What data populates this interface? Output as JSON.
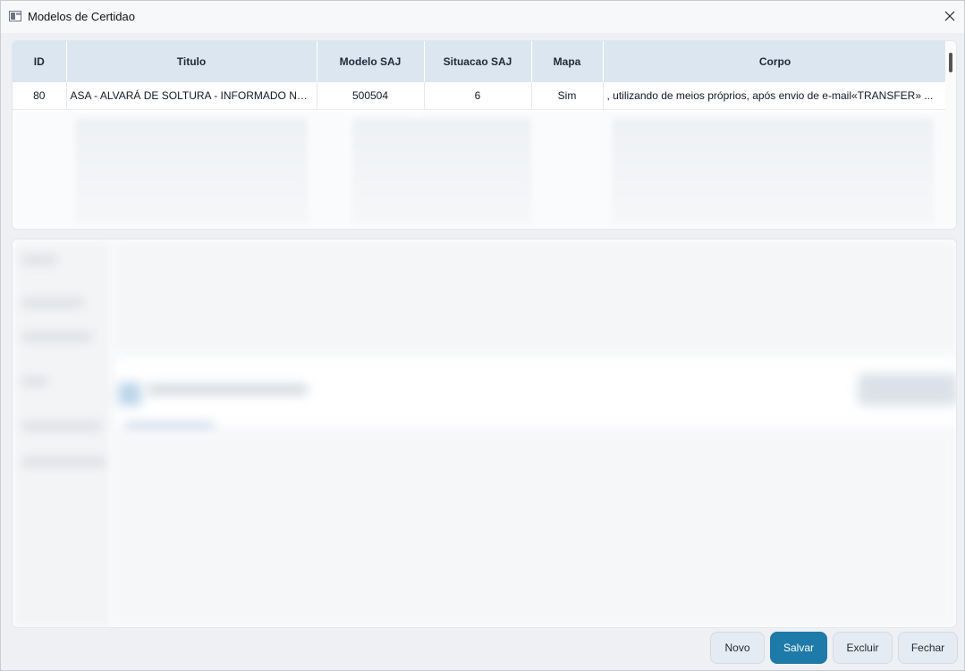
{
  "window": {
    "title": "Modelos de Certidao"
  },
  "grid": {
    "columns": [
      "ID",
      "Titulo",
      "Modelo SAJ",
      "Situacao SAJ",
      "Mapa",
      "Corpo"
    ],
    "rows": [
      {
        "id": "80",
        "titulo": "ASA - ALVARÁ DE SOLTURA - INFORMADO NA ...",
        "modelo_saj": "500504",
        "situacao_saj": "6",
        "mapa": "Sim",
        "corpo": ", utilizando de meios próprios, após envio de e-mail«TRANSFER» ..."
      }
    ]
  },
  "buttons": {
    "novo": "Novo",
    "salvar": "Salvar",
    "excluir": "Excluir",
    "fechar": "Fechar"
  },
  "colors": {
    "accent": "#1e7aa8",
    "header_bg": "#dbe6f0"
  }
}
